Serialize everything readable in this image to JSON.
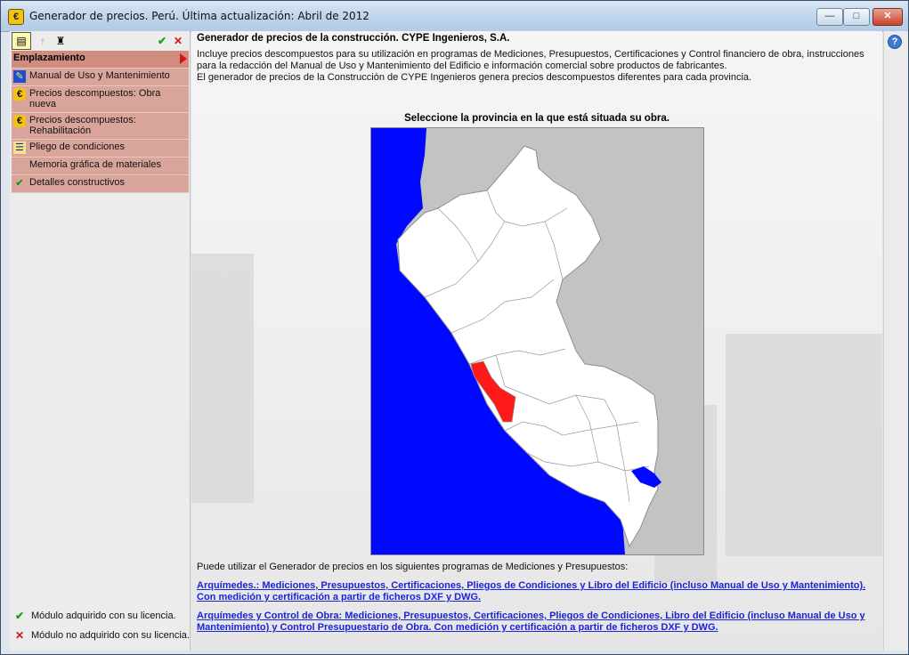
{
  "window": {
    "title": "Generador de precios. Perú. Última actualización: Abril de 2012",
    "app_icon": "€",
    "controls": {
      "minimize": "—",
      "maximize": "□",
      "close": "✕"
    }
  },
  "toolbar": {
    "items": [
      {
        "icon": "▤",
        "name": "list-view-icon"
      },
      {
        "icon": "↑",
        "name": "up-arrow-icon"
      },
      {
        "icon": "♜",
        "name": "binoculars-icon"
      }
    ],
    "accept": "✔",
    "cancel": "✕"
  },
  "sidebar": {
    "header": "Emplazamiento",
    "items": [
      {
        "label": "Manual de Uso y Mantenimiento",
        "icon": "✎"
      },
      {
        "label": "Precios descompuestos: Obra nueva",
        "icon": "€"
      },
      {
        "label": "Precios descompuestos: Rehabilitación",
        "icon": "€"
      },
      {
        "label": "Pliego de condiciones",
        "icon": "☰"
      },
      {
        "label": "Memoria gráfica de materiales",
        "icon": ""
      },
      {
        "label": "Detalles constructivos",
        "icon": "✔"
      }
    ],
    "legend": [
      {
        "mark": "✔",
        "text": "Módulo adquirido con su licencia.",
        "color": "#1f9b1f"
      },
      {
        "mark": "✕",
        "text": "Módulo no adquirido con su licencia.",
        "color": "#d01515"
      }
    ]
  },
  "content": {
    "title": "Generador de precios de la construcción. CYPE Ingenieros, S.A.",
    "description": [
      "Incluye precios descompuestos para su utilización en programas de Mediciones, Presupuestos, Certificaciones y Control financiero de obra, instrucciones para la redacción del Manual de Uso y Mantenimiento del Edificio e información comercial sobre productos de fabricantes.",
      "El generador de precios de la Construcción de CYPE Ingenieros genera precios descompuestos diferentes para cada provincia."
    ],
    "map_caption": "Seleccione la provincia en la que está situada su obra.",
    "programs_intro": "Puede utilizar el Generador de precios en los siguientes programas de Mediciones y Presupuestos:",
    "program_links": [
      "Arquímedes.: Mediciones, Presupuestos, Certificaciones, Pliegos de Condiciones y Libro del Edificio (incluso Manual de Uso y Mantenimiento). Con medición y certificación a partir de ficheros DXF y DWG.",
      "Arquímedes y Control de Obra: Mediciones, Presupuestos, Certificaciones, Pliegos de Condiciones, Libro del Edificio (incluso Manual de Uso y Mantenimiento) y Control Presupuestario de Obra. Con medición y certificación a partir de ficheros DXF y DWG."
    ],
    "help_icon": "?"
  },
  "colors": {
    "sea": "#0008ff",
    "land_other": "#c3c3c3",
    "province": "#ffffff",
    "province_selected": "#ff1a1a",
    "link": "#1b24d8"
  }
}
